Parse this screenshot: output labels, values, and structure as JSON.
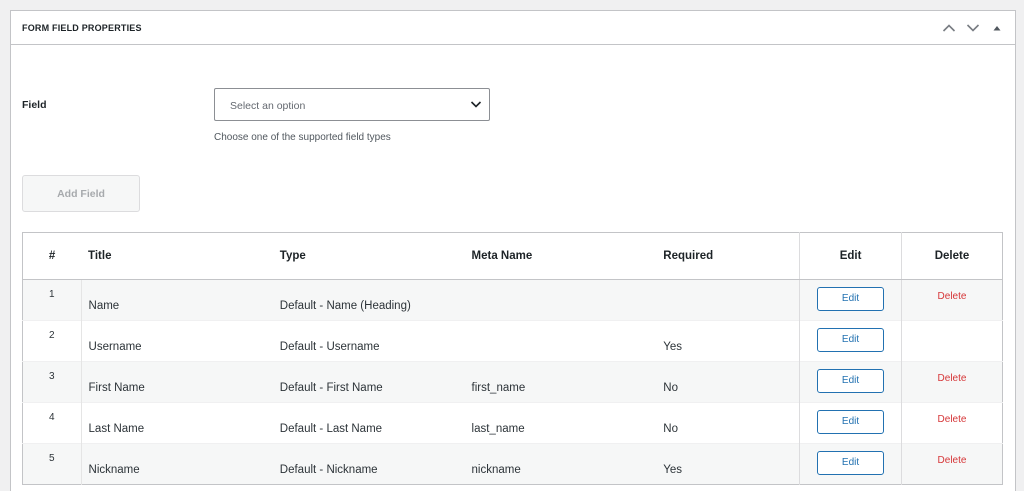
{
  "panel": {
    "title": "FORM FIELD PROPERTIES",
    "controls": [
      "chevron-up-icon",
      "chevron-down-icon",
      "caret-up-icon"
    ]
  },
  "field": {
    "label": "Field",
    "placeholder": "Select an option",
    "help": "Choose one of the supported field types"
  },
  "add_button": {
    "label": "Add Field"
  },
  "table": {
    "headers": {
      "num": "#",
      "title": "Title",
      "type": "Type",
      "meta": "Meta Name",
      "required": "Required",
      "edit": "Edit",
      "delete": "Delete"
    },
    "rows": [
      {
        "num": "1",
        "title": "Name",
        "type": "Default - Name (Heading)",
        "meta": "",
        "required": "",
        "edit": "Edit",
        "delete": "Delete"
      },
      {
        "num": "2",
        "title": "Username",
        "type": "Default - Username",
        "meta": "",
        "required": "Yes",
        "edit": "Edit",
        "delete": ""
      },
      {
        "num": "3",
        "title": "First Name",
        "type": "Default - First Name",
        "meta": "first_name",
        "required": "No",
        "edit": "Edit",
        "delete": "Delete"
      },
      {
        "num": "4",
        "title": "Last Name",
        "type": "Default - Last Name",
        "meta": "last_name",
        "required": "No",
        "edit": "Edit",
        "delete": "Delete"
      },
      {
        "num": "5",
        "title": "Nickname",
        "type": "Default - Nickname",
        "meta": "nickname",
        "required": "Yes",
        "edit": "Edit",
        "delete": "Delete"
      }
    ]
  },
  "colors": {
    "accent": "#2271b1",
    "danger": "#d63638",
    "border": "#c3c4c7"
  }
}
